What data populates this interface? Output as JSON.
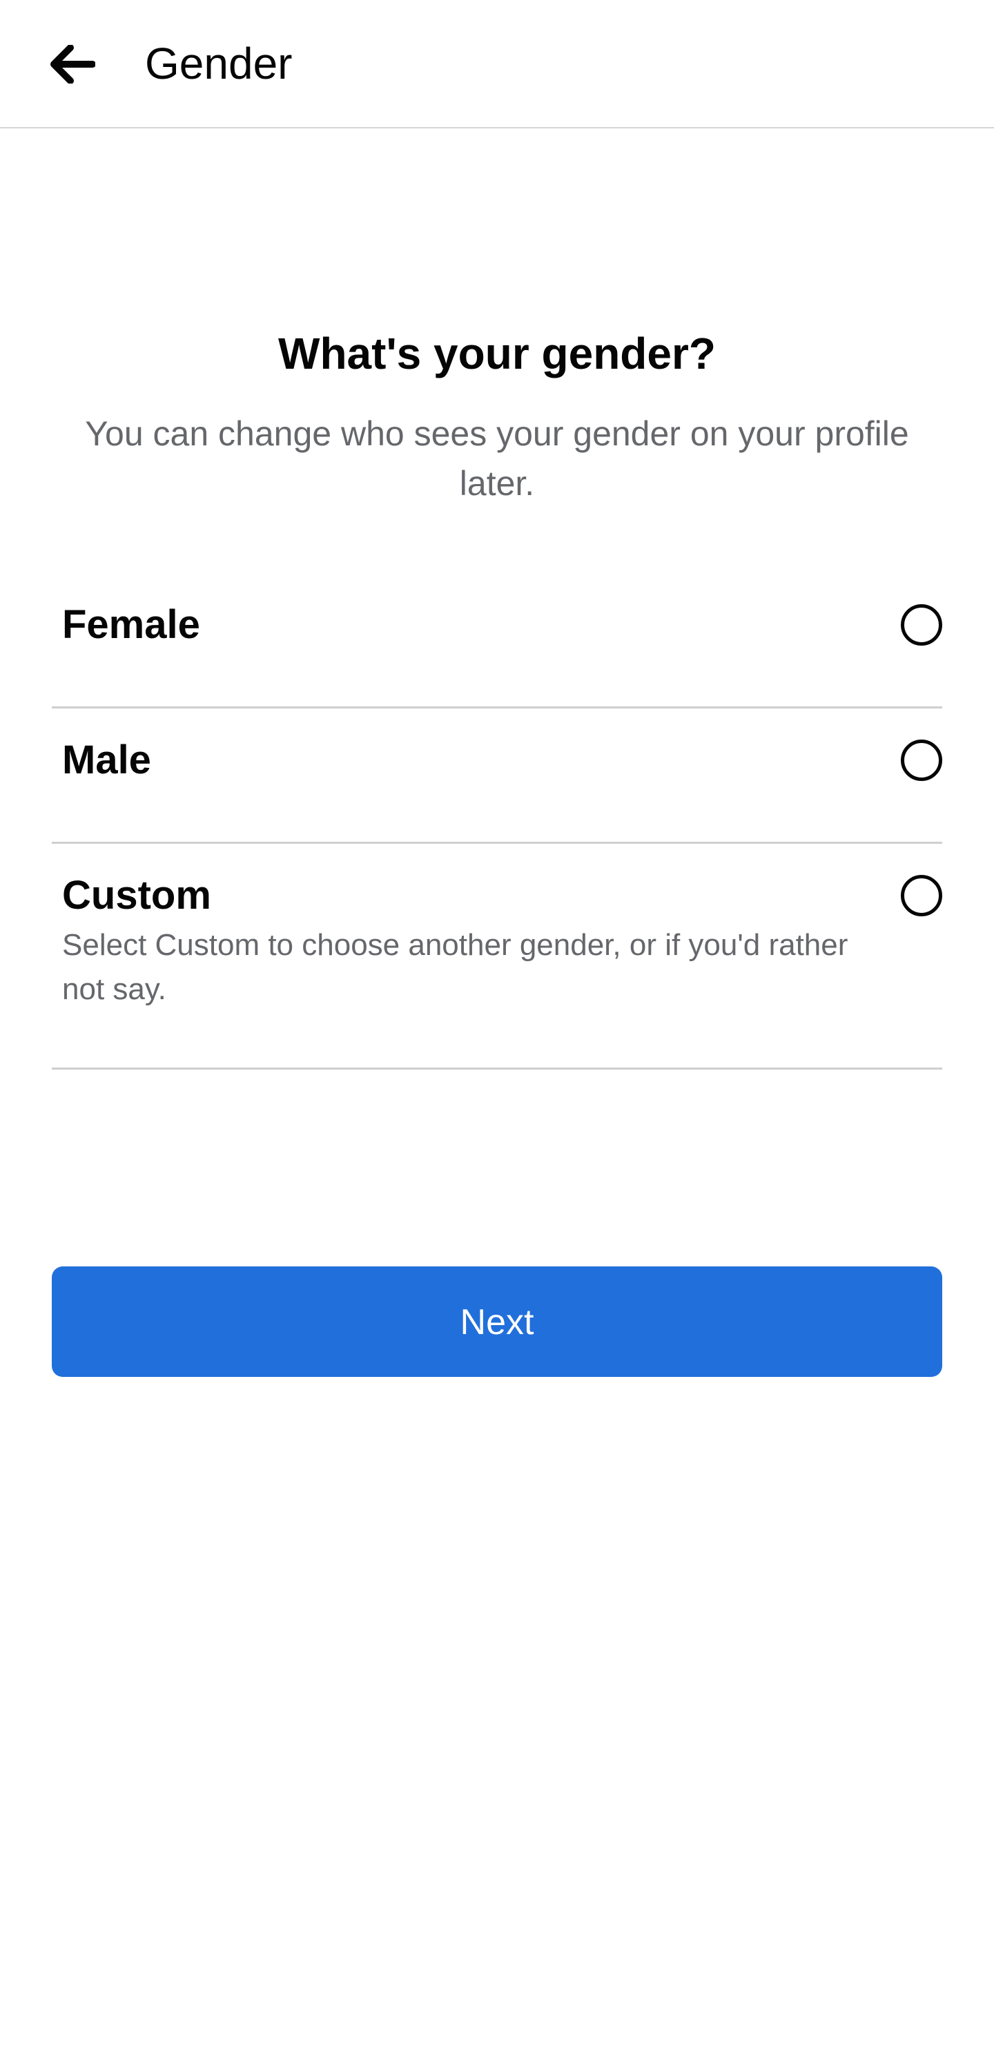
{
  "header": {
    "back_icon": "arrow-left-icon",
    "title": "Gender"
  },
  "question": {
    "title": "What's your gender?",
    "subtitle": "You can change who sees your gender on your profile later."
  },
  "options": [
    {
      "label": "Female",
      "description": "",
      "selected": false
    },
    {
      "label": "Male",
      "description": "",
      "selected": false
    },
    {
      "label": "Custom",
      "description": "Select Custom to choose another gender, or if you'd rather not say.",
      "selected": false
    }
  ],
  "next_button": {
    "label": "Next"
  },
  "colors": {
    "accent": "#216fdb",
    "text_primary": "#050505",
    "text_secondary": "#65676b",
    "divider": "#cfcfcf"
  }
}
